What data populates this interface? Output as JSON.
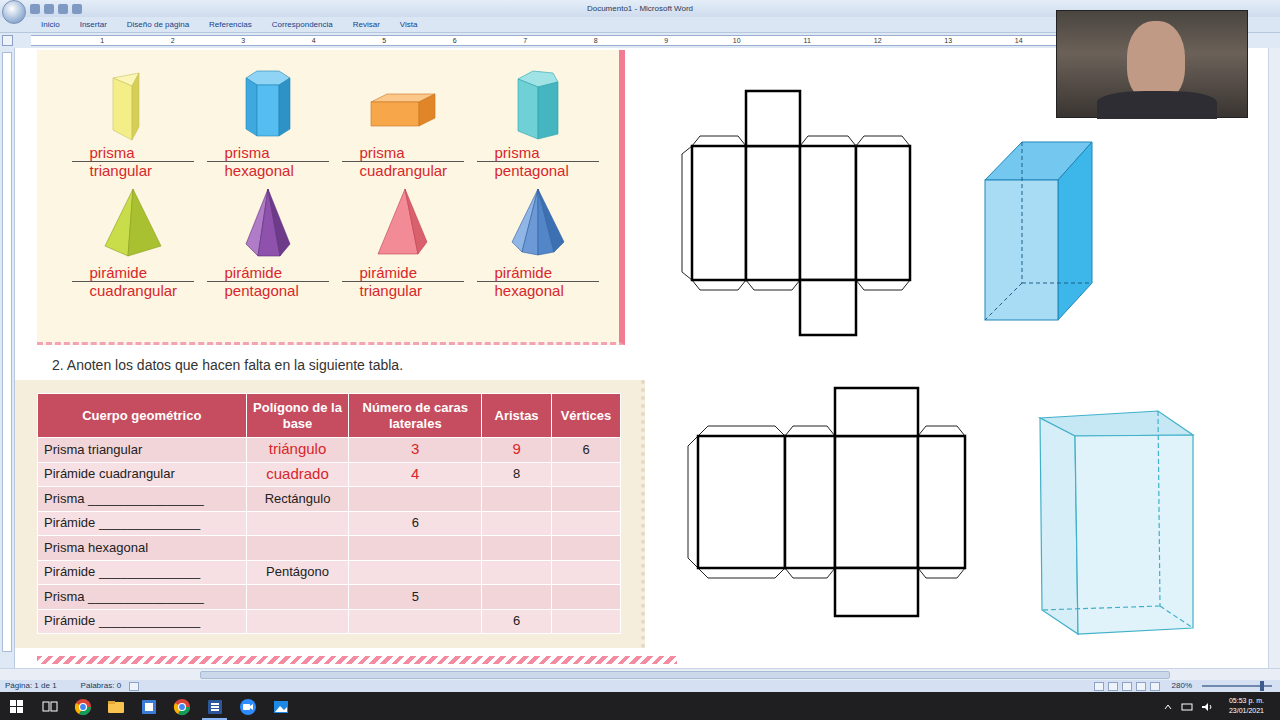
{
  "window": {
    "title": "Documento1 - Microsoft Word"
  },
  "ribbon_tabs": [
    {
      "label": "Inicio",
      "selected": false
    },
    {
      "label": "Insertar",
      "selected": false
    },
    {
      "label": "Diseño de página",
      "selected": false
    },
    {
      "label": "Referencias",
      "selected": false
    },
    {
      "label": "Correspondencia",
      "selected": false
    },
    {
      "label": "Revisar",
      "selected": false
    },
    {
      "label": "Vista",
      "selected": false
    }
  ],
  "ruler": [
    "1",
    "2",
    "3",
    "4",
    "5",
    "6",
    "7",
    "8",
    "9",
    "10",
    "11",
    "12",
    "13",
    "14"
  ],
  "document": {
    "shapes": [
      {
        "line1": "prisma",
        "line2": "triangular",
        "kind": "triangular-prism"
      },
      {
        "line1": "prisma",
        "line2": "hexagonal",
        "kind": "hexagonal-prism"
      },
      {
        "line1": "prisma",
        "line2": "cuadrangular",
        "kind": "cuadrangular-prism"
      },
      {
        "line1": "prisma",
        "line2": "pentagonal",
        "kind": "pentagonal-prism"
      },
      {
        "line1": "pirámide",
        "line2": "cuadrangular",
        "kind": "cuadrangular-pyramid"
      },
      {
        "line1": "pirámide",
        "line2": "pentagonal",
        "kind": "pentagonal-pyramid"
      },
      {
        "line1": "pirámide",
        "line2": "triangular",
        "kind": "triangular-pyramid"
      },
      {
        "line1": "pirámide",
        "line2": "hexagonal",
        "kind": "hexagonal-pyramid"
      }
    ],
    "question": "2. Anoten los datos que hacen falta en la siguiente tabla.",
    "table": {
      "columns": [
        "Cuerpo geométrico",
        "Polígono de la base",
        "Número de caras laterales",
        "Aristas",
        "Vértices"
      ],
      "rows": [
        [
          {
            "text": "Prisma triangular",
            "answer": false
          },
          {
            "text": "triángulo",
            "answer": true
          },
          {
            "text": "3",
            "answer": true
          },
          {
            "text": "9",
            "answer": true
          },
          {
            "text": "6",
            "answer": false
          }
        ],
        [
          {
            "text": "Pirámide cuadrangular",
            "answer": false
          },
          {
            "text": "cuadrado",
            "answer": true
          },
          {
            "text": "4",
            "answer": true
          },
          {
            "text": "8",
            "answer": false
          },
          {
            "text": "",
            "answer": false
          }
        ],
        [
          {
            "text": "Prisma ________________",
            "answer": false
          },
          {
            "text": "Rectángulo",
            "answer": false
          },
          {
            "text": "",
            "answer": false
          },
          {
            "text": "",
            "answer": false
          },
          {
            "text": "",
            "answer": false
          }
        ],
        [
          {
            "text": "Pirámide ______________",
            "answer": false
          },
          {
            "text": "",
            "answer": false
          },
          {
            "text": "6",
            "answer": false
          },
          {
            "text": "",
            "answer": false
          },
          {
            "text": "",
            "answer": false
          }
        ],
        [
          {
            "text": "Prisma hexagonal",
            "answer": false
          },
          {
            "text": "",
            "answer": false
          },
          {
            "text": "",
            "answer": false
          },
          {
            "text": "",
            "answer": false
          },
          {
            "text": "",
            "answer": false
          }
        ],
        [
          {
            "text": "Pirámide ______________",
            "answer": false
          },
          {
            "text": "Pentágono",
            "answer": false
          },
          {
            "text": "",
            "answer": false
          },
          {
            "text": "",
            "answer": false
          },
          {
            "text": "",
            "answer": false
          }
        ],
        [
          {
            "text": "Prisma ________________",
            "answer": false
          },
          {
            "text": "",
            "answer": false
          },
          {
            "text": "5",
            "answer": false
          },
          {
            "text": "",
            "answer": false
          },
          {
            "text": "",
            "answer": false
          }
        ],
        [
          {
            "text": "Pirámide ______________",
            "answer": false
          },
          {
            "text": "",
            "answer": false
          },
          {
            "text": "",
            "answer": false
          },
          {
            "text": "6",
            "answer": false
          },
          {
            "text": "",
            "answer": false
          }
        ]
      ]
    }
  },
  "status_bar": {
    "page": "Página: 1 de 1",
    "words": "Palabras: 0",
    "zoom": "280%",
    "zoom_level": 0.85
  },
  "taskbar": {
    "apps": [
      {
        "kind": "chrome",
        "selected": false
      },
      {
        "kind": "folder",
        "selected": false
      },
      {
        "kind": "editor",
        "selected": false
      },
      {
        "kind": "chrome",
        "selected": false
      },
      {
        "kind": "word",
        "selected": true
      },
      {
        "kind": "zoom",
        "selected": false
      },
      {
        "kind": "photos",
        "selected": false
      }
    ],
    "time": "05:53 p. m.",
    "date": "23/01/2021"
  }
}
